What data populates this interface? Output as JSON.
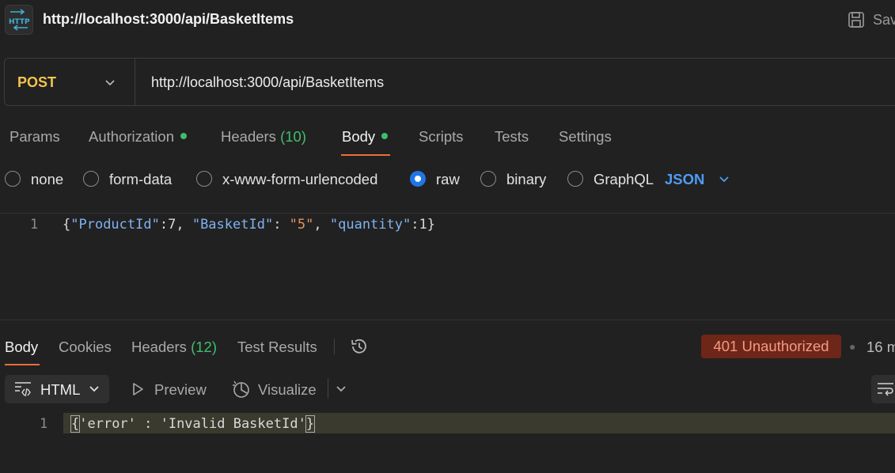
{
  "window": {
    "title": "http://localhost:3000/api/BasketItems",
    "save_label": "Sav",
    "icon": "http-icon"
  },
  "request": {
    "method": "POST",
    "url": "http://localhost:3000/api/BasketItems"
  },
  "request_tabs": [
    {
      "label": "Params"
    },
    {
      "label": "Authorization",
      "dot": true
    },
    {
      "label": "Headers",
      "count": "(10)"
    },
    {
      "label": "Body",
      "dot": true,
      "active": true
    },
    {
      "label": "Scripts"
    },
    {
      "label": "Tests"
    },
    {
      "label": "Settings"
    }
  ],
  "body_types": [
    {
      "label": "none",
      "selected": false
    },
    {
      "label": "form-data",
      "selected": false
    },
    {
      "label": "x-www-form-urlencoded",
      "selected": false
    },
    {
      "label": "raw",
      "selected": true
    },
    {
      "label": "binary",
      "selected": false
    },
    {
      "label": "GraphQL",
      "selected": false
    }
  ],
  "body_format": "JSON",
  "request_body": {
    "line_number": "1",
    "tokens": {
      "open": "{",
      "k1": "\"ProductId\"",
      "c1": ":",
      "v1": "7",
      "sep1": ", ",
      "k2": "\"BasketId\"",
      "c2": ": ",
      "v2": "\"5\"",
      "sep2": ", ",
      "k3": "\"quantity\"",
      "c3": ":",
      "v3": "1",
      "close": "}"
    }
  },
  "response_tabs": [
    {
      "label": "Body",
      "active": true
    },
    {
      "label": "Cookies"
    },
    {
      "label": "Headers",
      "count": "(12)"
    },
    {
      "label": "Test Results"
    }
  ],
  "response": {
    "status": "401 Unauthorized",
    "time": "16 m",
    "format": "HTML",
    "preview_label": "Preview",
    "visualize_label": "Visualize",
    "line_number": "1",
    "open": "{",
    "text": "'error' : 'Invalid BasketId'",
    "close": "}"
  },
  "colors": {
    "method": "#f3c44c",
    "accent": "#f26b3a",
    "status_bg": "#6e2619",
    "radio_selected": "#1f76e5"
  }
}
